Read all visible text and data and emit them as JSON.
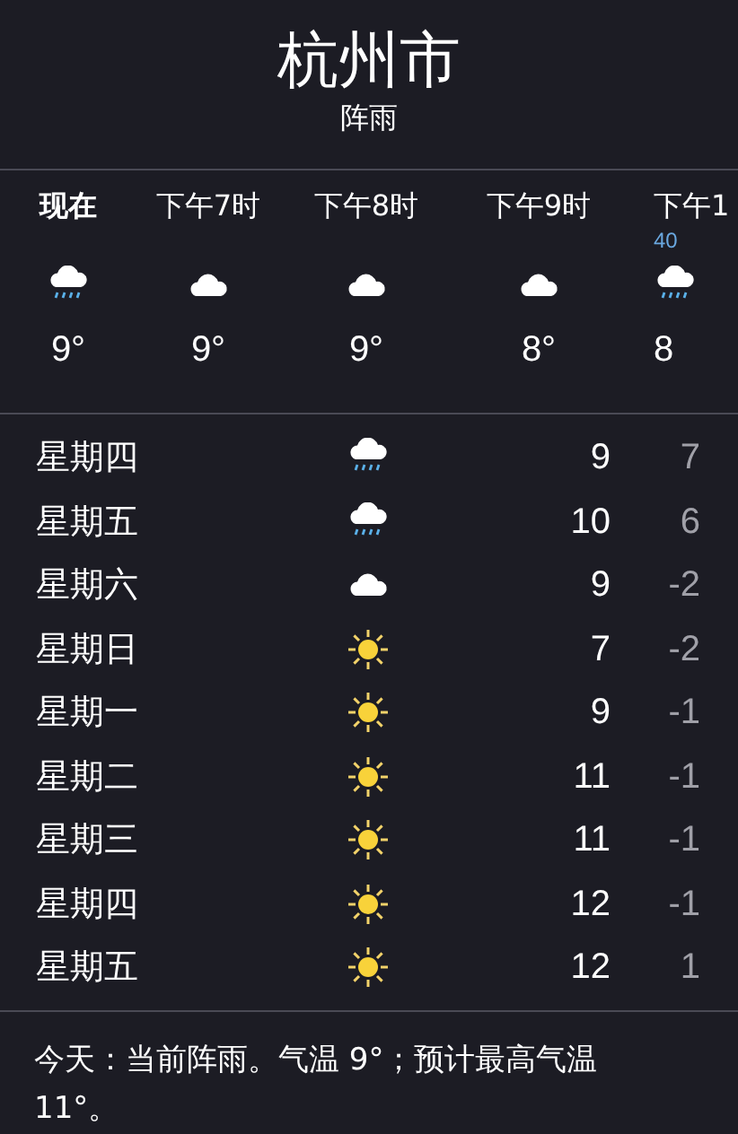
{
  "header": {
    "city": "杭州市",
    "condition": "阵雨"
  },
  "hourly": [
    {
      "time": "现在",
      "kind": "rain",
      "temp": "9°",
      "selected": true
    },
    {
      "time": "下午7时",
      "kind": "cloud",
      "temp": "9°",
      "selected": false
    },
    {
      "time": "下午8时",
      "kind": "cloud",
      "temp": "9°",
      "selected": false
    },
    {
      "time": "下午9时",
      "kind": "cloud",
      "temp": "8°",
      "selected": false
    },
    {
      "time": "下午1",
      "chance": "40",
      "kind": "rain",
      "temp": "8",
      "selected": false
    }
  ],
  "daily": [
    {
      "day": "星期四",
      "kind": "rain",
      "high": "9",
      "low": "7"
    },
    {
      "day": "星期五",
      "kind": "rain",
      "high": "10",
      "low": "6"
    },
    {
      "day": "星期六",
      "kind": "cloud",
      "high": "9",
      "low": "-2"
    },
    {
      "day": "星期日",
      "kind": "sun",
      "high": "7",
      "low": "-2"
    },
    {
      "day": "星期一",
      "kind": "sun",
      "high": "9",
      "low": "-1"
    },
    {
      "day": "星期二",
      "kind": "sun",
      "high": "11",
      "low": "-1"
    },
    {
      "day": "星期三",
      "kind": "sun",
      "high": "11",
      "low": "-1"
    },
    {
      "day": "星期四",
      "kind": "sun",
      "high": "12",
      "low": "-1"
    },
    {
      "day": "星期五",
      "kind": "sun",
      "high": "12",
      "low": "1"
    }
  ],
  "summary": "今天：当前阵雨。气温 9°；预计最高气温 11°。"
}
